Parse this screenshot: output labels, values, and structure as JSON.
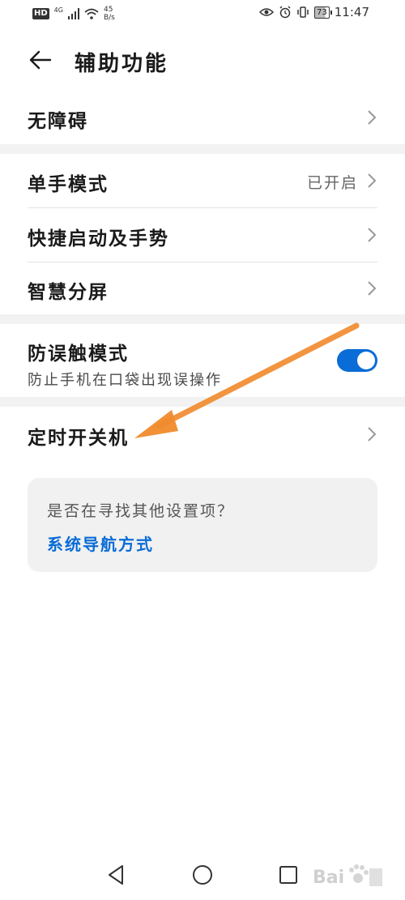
{
  "status_bar": {
    "hd": "HD",
    "network": "4G",
    "speed_value": "45",
    "speed_unit": "B/s",
    "battery": "73",
    "time": "11:47"
  },
  "header": {
    "title": "辅助功能"
  },
  "rows": {
    "accessibility": {
      "label": "无障碍"
    },
    "one_hand": {
      "label": "单手模式",
      "value": "已开启"
    },
    "quick_launch": {
      "label": "快捷启动及手势"
    },
    "smart_split": {
      "label": "智慧分屏"
    },
    "pocket_mode": {
      "label": "防误触模式",
      "sublabel": "防止手机在口袋出现误操作",
      "enabled": true
    },
    "scheduled_power": {
      "label": "定时开关机"
    }
  },
  "suggestion": {
    "question": "是否在寻找其他设置项？",
    "link": "系统导航方式"
  },
  "watermark": {
    "text": "Bai"
  },
  "colors": {
    "accent": "#0a6cd6",
    "annotation_arrow": "#f08a2c",
    "section_gap": "#f2f2f2"
  }
}
